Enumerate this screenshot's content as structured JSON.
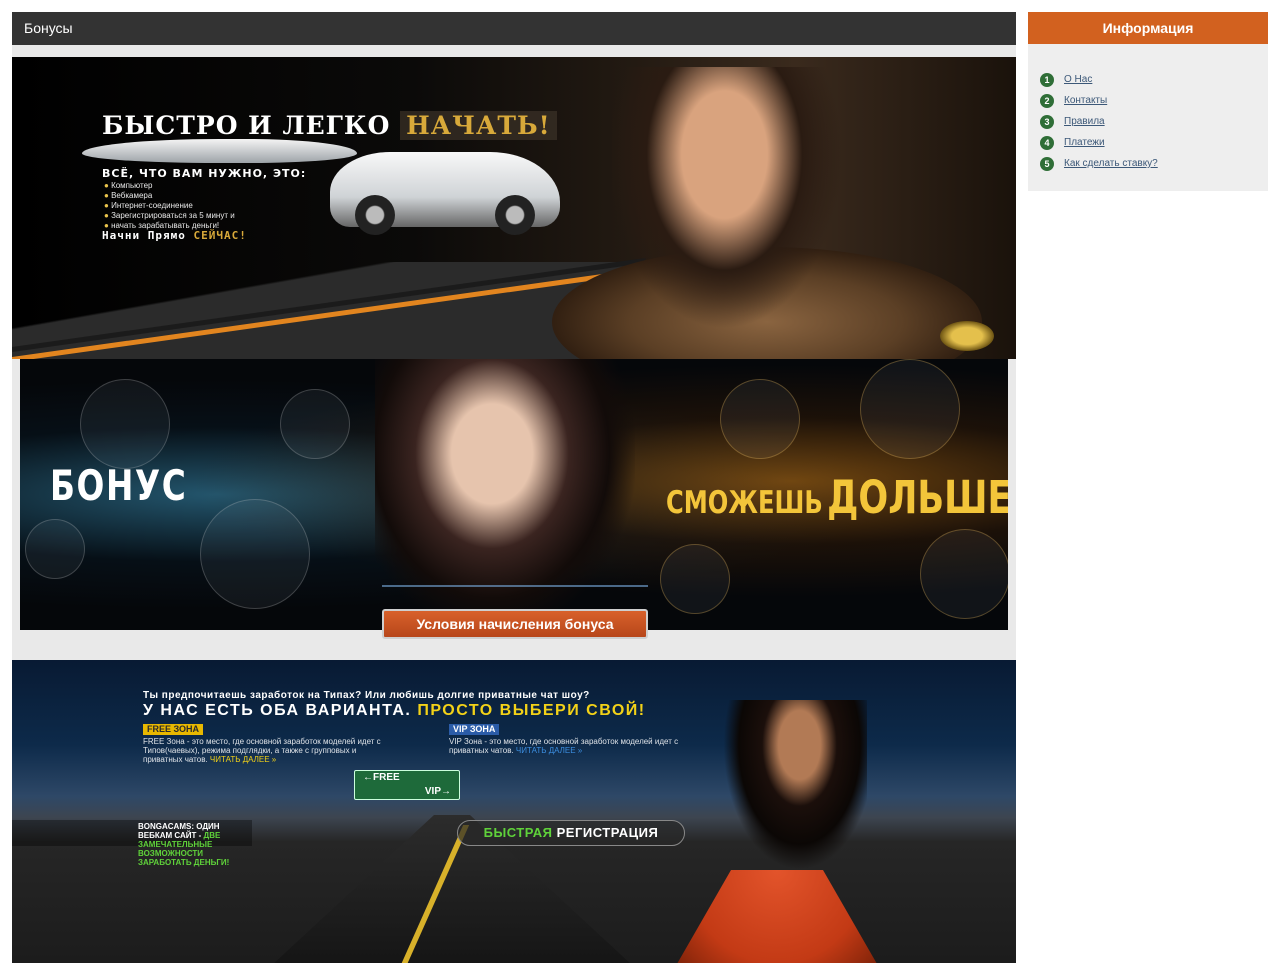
{
  "main": {
    "title": "Бонусы"
  },
  "banner1": {
    "title_white": "БЫСТРО И ЛЕГКО",
    "title_gold": "НАЧАТЬ!",
    "subtitle": "ВСЁ, ЧТО ВАМ НУЖНО, ЭТО:",
    "items": [
      "Компьютер",
      "Вебкамера",
      "Интернет-соединение",
      "Зарегистрироваться за 5 минут и",
      "начать зарабатывать деньги!"
    ],
    "cta_white": "Начни Прямо",
    "cta_gold": "СЕЙЧАС!"
  },
  "banner2": {
    "left_text": "БОНУС",
    "right_small": "СМОЖЕШЬ",
    "right_big": "ДОЛЬШЕ",
    "button_label": "Условия начисления бонуса"
  },
  "banner3": {
    "question": "Ты предпочитаешь заработок на Типах? Или любишь долгие приватные чат шоу?",
    "headline_white": "У НАС ЕСТЬ ОБА ВАРИАНТА.",
    "headline_yellow": "ПРОСТО ВЫБЕРИ СВОЙ!",
    "free_tag": "FREE ЗОНА",
    "free_text": "FREE Зона - это место, где основной заработок моделей идет с Типов(чаевых), режима подглядки, а также с групповых и приватных чатов.",
    "free_more": "ЧИТАТЬ ДАЛЕЕ »",
    "vip_tag": "VIP ЗОНА",
    "vip_text": "VIP Зона - это место, где основной заработок моделей идет с приватных чатов.",
    "vip_more": "ЧИТАТЬ ДАЛЕЕ »",
    "sign_free": "←FREE",
    "sign_vip": "VIP→",
    "promo_white": "BONGACAMS: ОДИН ВЕБКАМ САЙТ -",
    "promo_green": "ДВЕ ЗАМЕЧАТЕЛЬНЫЕ ВОЗМОЖНОСТИ ЗАРАБОТАТЬ ДЕНЬГИ!",
    "reg_green": "БЫСТРАЯ",
    "reg_white": "РЕГИСТРАЦИЯ"
  },
  "sidebar": {
    "title": "Информация",
    "items": [
      {
        "num": "1",
        "label": "О Нас"
      },
      {
        "num": "2",
        "label": "Контакты"
      },
      {
        "num": "3",
        "label": "Правила"
      },
      {
        "num": "4",
        "label": "Платежи"
      },
      {
        "num": "5",
        "label": "Как сделать ставку?"
      }
    ]
  },
  "colors": {
    "header_bg": "#333333",
    "sidebar_accent": "#d2611f",
    "badge_green": "#2f6e37",
    "link": "#3c5878"
  }
}
